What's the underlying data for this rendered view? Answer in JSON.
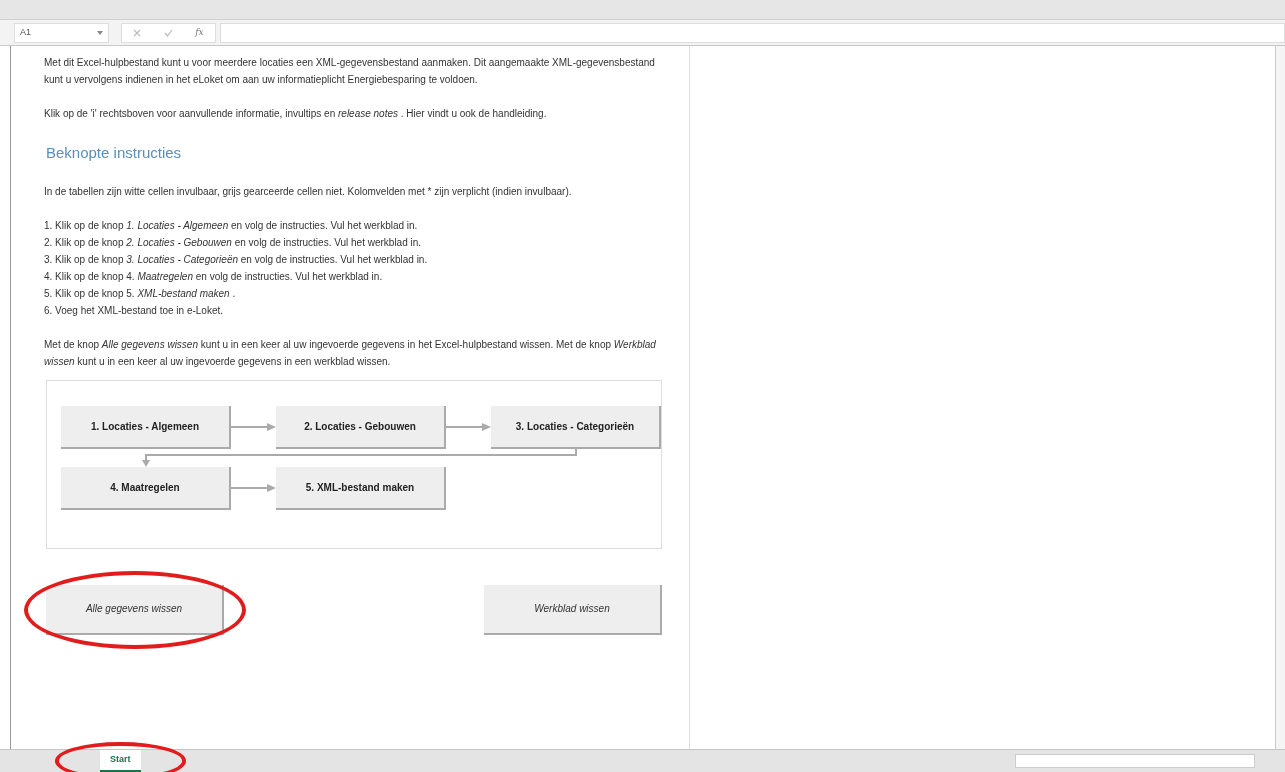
{
  "formula_bar": {
    "name_box": "A1",
    "function_label": "fx"
  },
  "intro": [
    "Met dit Excel-hulpbestand kunt u voor meerdere locaties een XML-gegevensbestand aanmaken. Dit aangemaakte XML-gegevensbestand kunt u vervolgens indienen in het eLoket om aan uw informatieplicht Energiebesparing te voldoen.",
    "Klik op de 'i' rechtsboven voor aanvullende informatie, invultips en *release notes* . Hier vindt u ook de handleiding."
  ],
  "heading": "Beknopte instructies",
  "note": "In de tabellen zijn witte cellen invulbaar, grijs gearceerde cellen niet. Kolomvelden met * zijn verplicht (indien invulbaar).",
  "steps": [
    "1. Klik op de knop *1. Locaties - Algemeen* en volg de instructies. Vul het werkblad in.",
    "2. Klik op de knop *2. Locaties - Gebouwen* en volg de instructies. Vul het werkblad in.",
    "3. Klik op de knop *3. Locaties - Categorieën* en volg de instructies. Vul het werkblad in.",
    "4. Klik op de knop 4. *Maatregelen* en volg de instructies. Vul het werkblad in.",
    "5. Klik op de knop 5. *XML-bestand maken* .",
    "6. Voeg het XML-bestand toe in e-Loket."
  ],
  "wipe_text": "Met de knop *Alle gegevens wissen* kunt u in een keer al uw ingevoerde gegevens in het Excel-hulpbestand wissen. Met de knop *Werkblad wissen* kunt u in een keer al uw ingevoerde gegevens in een werkblad wissen.",
  "flow_rows": [
    [
      "1. Locaties - Algemeen",
      "2. Locaties - Gebouwen",
      "3. Locaties - Categorieën"
    ],
    [
      "4. Maatregelen",
      "5. XML-bestand maken"
    ]
  ],
  "buttons": [
    {
      "label": "Alle gegevens wissen",
      "circled": true
    },
    {
      "label": "Werkblad wissen",
      "circled": false
    }
  ],
  "sheet_tabs": [
    {
      "label": "Start",
      "selected": true,
      "circled": true
    }
  ]
}
